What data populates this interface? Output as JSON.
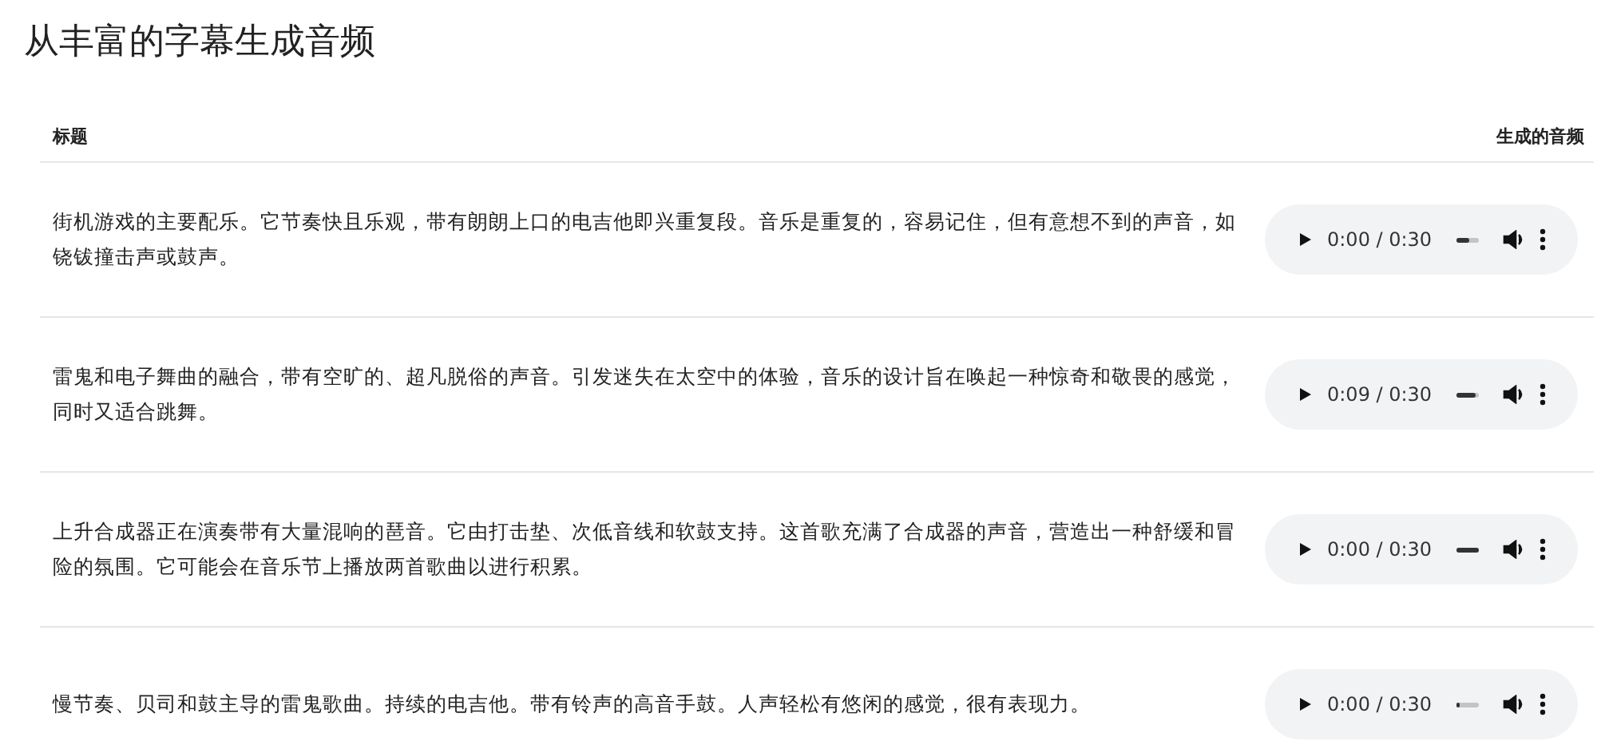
{
  "title": "从丰富的字幕生成音频",
  "table": {
    "columns": [
      "标题",
      "生成的音频"
    ],
    "rows": [
      {
        "caption": "街机游戏的主要配乐。它节奏快且乐观，带有朗朗上口的电吉他即兴重复段。音乐是重复的，容易记住，但有意想不到的声音，如铙钹撞击声或鼓声。",
        "time": "0:00 / 0:30",
        "level": 0.55
      },
      {
        "caption": "雷鬼和电子舞曲的融合，带有空旷的、超凡脱俗的声音。引发迷失在太空中的体验，音乐的设计旨在唤起一种惊奇和敬畏的感觉，同时又适合跳舞。",
        "time": "0:09 / 0:30",
        "level": 0.85
      },
      {
        "caption": "上升合成器正在演奏带有大量混响的琶音。它由打击垫、次低音线和软鼓支持。这首歌充满了合成器的声音，营造出一种舒缓和冒险的氛围。它可能会在音乐节上播放两首歌曲以进行积累。",
        "time": "0:00 / 0:30",
        "level": 1.0
      },
      {
        "caption": "慢节奏、贝司和鼓主导的雷鬼歌曲。持续的电吉他。带有铃声的高音手鼓。人声轻松有悠闲的感觉，很有表现力。",
        "time": "0:00 / 0:30",
        "level": 0.2
      }
    ]
  }
}
